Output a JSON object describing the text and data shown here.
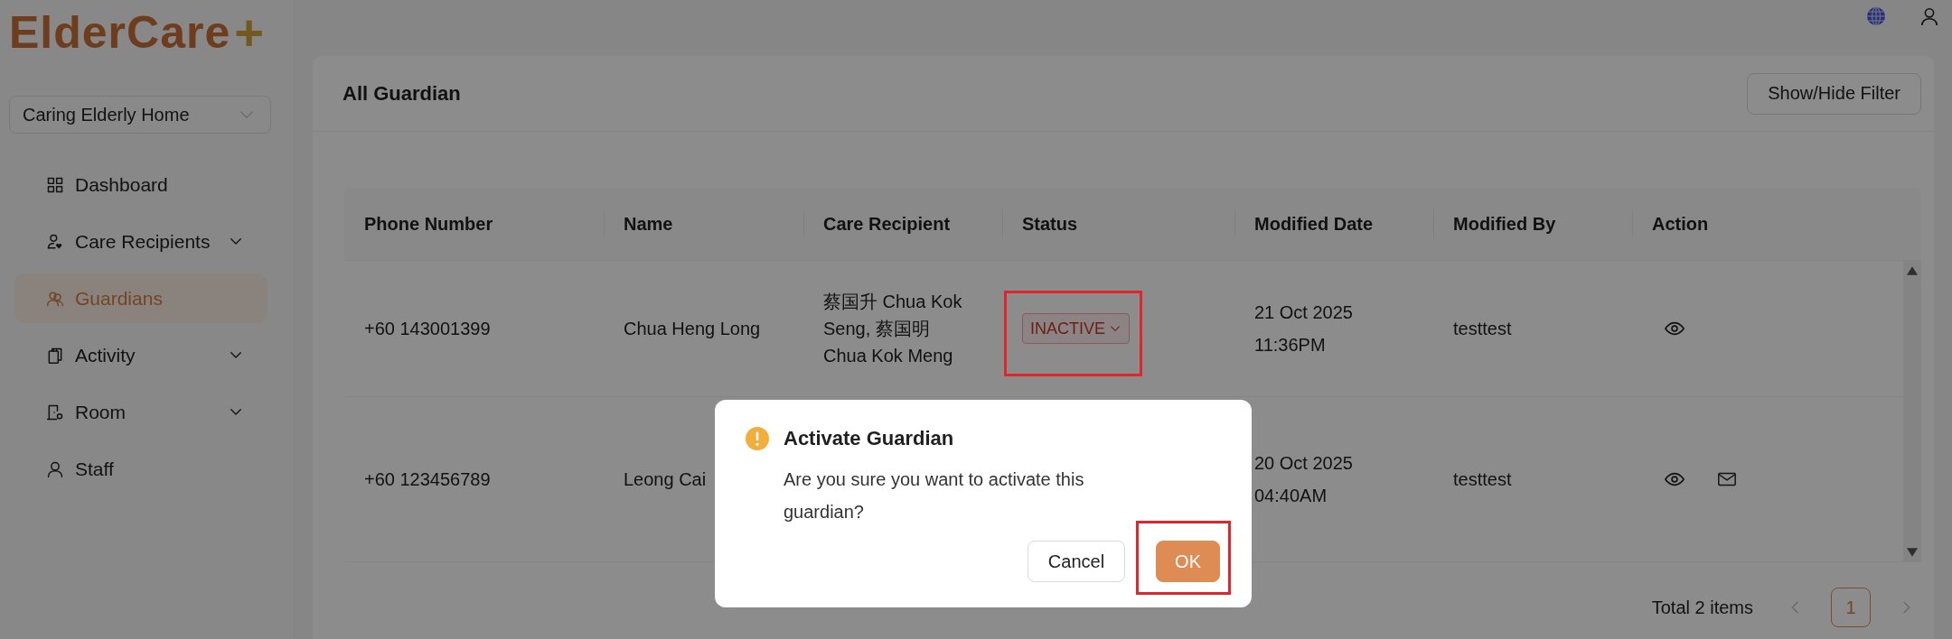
{
  "logo": {
    "text": "ElderCare",
    "mark": "+"
  },
  "facility_select": {
    "value": "Caring Elderly Home"
  },
  "sidebar": {
    "items": [
      {
        "label": "Dashboard",
        "expandable": false,
        "selected": false
      },
      {
        "label": "Care Recipients",
        "expandable": true,
        "selected": false
      },
      {
        "label": "Guardians",
        "expandable": false,
        "selected": true
      },
      {
        "label": "Activity",
        "expandable": true,
        "selected": false
      },
      {
        "label": "Room",
        "expandable": true,
        "selected": false
      },
      {
        "label": "Staff",
        "expandable": false,
        "selected": false
      }
    ]
  },
  "page": {
    "title": "All Guardian",
    "filter_button": "Show/Hide Filter"
  },
  "table": {
    "columns": [
      "Phone Number",
      "Name",
      "Care Recipient",
      "Status",
      "Modified Date",
      "Modified By",
      "Action"
    ],
    "rows": [
      {
        "phone": "+60 143001399",
        "name": "Chua Heng Long",
        "care_recipient": "蔡国升 Chua Kok Seng, 蔡国明 Chua Kok Meng",
        "status": {
          "label": "INACTIVE",
          "active": false,
          "highlighted": true
        },
        "modified_date": "21 Oct 2025 11:36PM",
        "modified_by": "testtest",
        "actions": [
          {
            "kind": "view"
          }
        ]
      },
      {
        "phone": "+60 123456789",
        "name": "Leong Cai",
        "modified_date": "20 Oct 2025 04:40AM",
        "modified_by": "testtest",
        "actions": [
          {
            "kind": "view"
          },
          {
            "kind": "email"
          }
        ]
      }
    ]
  },
  "pagination": {
    "total": "Total 2 items",
    "pages": [
      {
        "label": "1",
        "selected": true
      }
    ]
  },
  "dialog": {
    "title": "Activate Guardian",
    "message": "Are you sure you want to activate this guardian?",
    "buttons": [
      {
        "label": "Cancel",
        "kind": "default"
      },
      {
        "label": "OK",
        "kind": "primary",
        "highlighted": true
      }
    ]
  }
}
